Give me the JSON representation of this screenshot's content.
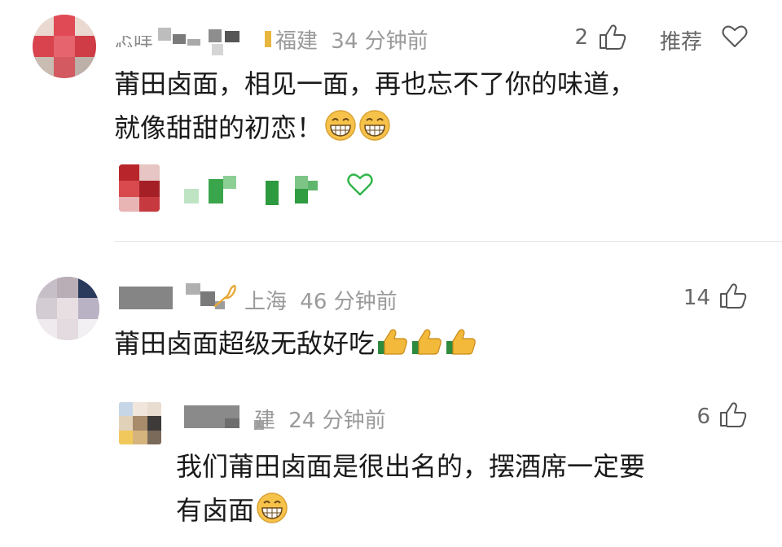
{
  "comments": [
    {
      "name_fragment": "忑咩",
      "location": "福建",
      "time_ago": "34 分钟前",
      "like_count": "2",
      "recommend_label": "推荐",
      "text_line1": "莆田卤面，相见一面，再也忘不了你的味道，",
      "text_line2": "就像甜甜的初恋！",
      "emoji": "grin-icon"
    },
    {
      "location": "上海",
      "time_ago": "46 分钟前",
      "like_count": "14",
      "text_line1": "莆田卤面超级无敌好吃",
      "emoji": "thumbs-up-icon"
    },
    {
      "location": "福建",
      "location_visible": "建",
      "time_ago": "24 分钟前",
      "like_count": "6",
      "text_line1": "我们莆田卤面是很出名的，摆酒席一定要",
      "text_line2": "有卤面",
      "emoji": "grin-icon"
    }
  ],
  "colors": {
    "meta_text": "#9a9a9a",
    "body_text": "#1a1a1a",
    "like_heart": "#2fb64a"
  }
}
